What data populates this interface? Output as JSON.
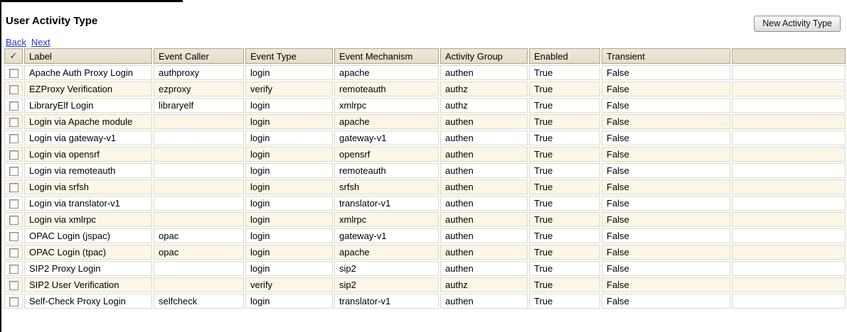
{
  "page": {
    "title": "User Activity Type",
    "back_link": "Back",
    "next_link": "Next",
    "new_button_label": "New Activity Type"
  },
  "colors": {
    "link_blue": "#2633cc",
    "header_bg": "#e9e2d0",
    "row_alt_bg": "#fbf6e7",
    "grid_border": "#dcd8c8"
  },
  "table": {
    "select_header_glyph": "✓",
    "columns": [
      {
        "key": "label",
        "label": "Label"
      },
      {
        "key": "event_caller",
        "label": "Event Caller"
      },
      {
        "key": "event_type",
        "label": "Event Type"
      },
      {
        "key": "event_mechanism",
        "label": "Event Mechanism"
      },
      {
        "key": "activity_group",
        "label": "Activity Group"
      },
      {
        "key": "enabled",
        "label": "Enabled"
      },
      {
        "key": "transient",
        "label": "Transient"
      }
    ],
    "rows": [
      {
        "label": "Apache Auth Proxy Login",
        "event_caller": "authproxy",
        "event_type": "login",
        "event_mechanism": "apache",
        "activity_group": "authen",
        "enabled": "True",
        "transient": "False"
      },
      {
        "label": "EZProxy Verification",
        "event_caller": "ezproxy",
        "event_type": "verify",
        "event_mechanism": "remoteauth",
        "activity_group": "authz",
        "enabled": "True",
        "transient": "False"
      },
      {
        "label": "LibraryElf Login",
        "event_caller": "libraryelf",
        "event_type": "login",
        "event_mechanism": "xmlrpc",
        "activity_group": "authz",
        "enabled": "True",
        "transient": "False"
      },
      {
        "label": "Login via Apache module",
        "event_caller": "",
        "event_type": "login",
        "event_mechanism": "apache",
        "activity_group": "authen",
        "enabled": "True",
        "transient": "False"
      },
      {
        "label": "Login via gateway-v1",
        "event_caller": "",
        "event_type": "login",
        "event_mechanism": "gateway-v1",
        "activity_group": "authen",
        "enabled": "True",
        "transient": "False"
      },
      {
        "label": "Login via opensrf",
        "event_caller": "",
        "event_type": "login",
        "event_mechanism": "opensrf",
        "activity_group": "authen",
        "enabled": "True",
        "transient": "False"
      },
      {
        "label": "Login via remoteauth",
        "event_caller": "",
        "event_type": "login",
        "event_mechanism": "remoteauth",
        "activity_group": "authen",
        "enabled": "True",
        "transient": "False"
      },
      {
        "label": "Login via srfsh",
        "event_caller": "",
        "event_type": "login",
        "event_mechanism": "srfsh",
        "activity_group": "authen",
        "enabled": "True",
        "transient": "False"
      },
      {
        "label": "Login via translator-v1",
        "event_caller": "",
        "event_type": "login",
        "event_mechanism": "translator-v1",
        "activity_group": "authen",
        "enabled": "True",
        "transient": "False"
      },
      {
        "label": "Login via xmlrpc",
        "event_caller": "",
        "event_type": "login",
        "event_mechanism": "xmlrpc",
        "activity_group": "authen",
        "enabled": "True",
        "transient": "False"
      },
      {
        "label": "OPAC Login (jspac)",
        "event_caller": "opac",
        "event_type": "login",
        "event_mechanism": "gateway-v1",
        "activity_group": "authen",
        "enabled": "True",
        "transient": "False"
      },
      {
        "label": "OPAC Login (tpac)",
        "event_caller": "opac",
        "event_type": "login",
        "event_mechanism": "apache",
        "activity_group": "authen",
        "enabled": "True",
        "transient": "False"
      },
      {
        "label": "SIP2 Proxy Login",
        "event_caller": "",
        "event_type": "login",
        "event_mechanism": "sip2",
        "activity_group": "authen",
        "enabled": "True",
        "transient": "False"
      },
      {
        "label": "SIP2 User Verification",
        "event_caller": "",
        "event_type": "verify",
        "event_mechanism": "sip2",
        "activity_group": "authz",
        "enabled": "True",
        "transient": "False"
      },
      {
        "label": "Self-Check Proxy Login",
        "event_caller": "selfcheck",
        "event_type": "login",
        "event_mechanism": "translator-v1",
        "activity_group": "authen",
        "enabled": "True",
        "transient": "False"
      }
    ]
  }
}
